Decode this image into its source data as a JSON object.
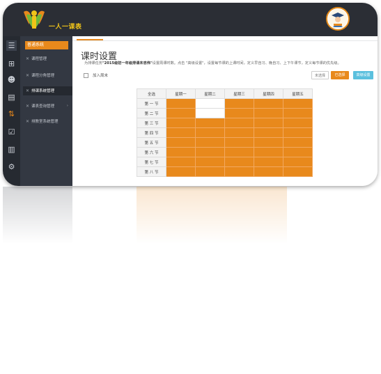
{
  "header": {
    "brand": "一人一课表",
    "colors": {
      "bar": "#2b2e35",
      "accent": "#e8891c"
    }
  },
  "iconbar": [
    {
      "icon": "list-icon",
      "glyph": "☰"
    },
    {
      "icon": "sitemap-icon",
      "glyph": "⊞"
    },
    {
      "icon": "users-icon",
      "glyph": "👥"
    },
    {
      "icon": "book-icon",
      "glyph": "▤"
    },
    {
      "icon": "sort-numeric-icon",
      "glyph": "⇅"
    },
    {
      "icon": "checkbox-icon",
      "glyph": "☑"
    },
    {
      "icon": "bar-chart-icon",
      "glyph": "▥"
    },
    {
      "icon": "gears-icon",
      "glyph": "⚙"
    }
  ],
  "sidebar": {
    "system_label": "普通系统",
    "items": [
      {
        "label": "课程管理",
        "icon": "wrench-icon"
      },
      {
        "label": "课程分角管理",
        "icon": "wrench-icon"
      },
      {
        "label": "排课系统管理",
        "icon": "wrench-icon",
        "active": true
      },
      {
        "label": "课表查询管理",
        "icon": "wrench-icon",
        "has_submenu": true
      },
      {
        "label": "排教室系统管理",
        "icon": "wrench-icon"
      }
    ]
  },
  "main": {
    "title": "课时设置",
    "description_prefix": "为排课任务",
    "description_task": "\"2015级初一年级排课未忠伟\"",
    "description_suffix": "设置周课时数。点击 \"高级设置\"，设置每节课的上课时间，定义早自习、晚自习、上下午课节，定义每节课的优先级。",
    "weekend_checkbox_label": "加入周末",
    "buttons": {
      "clear": "未选择",
      "selected": "已选择",
      "advanced": "高级设置"
    },
    "table": {
      "corner": "全选",
      "days": [
        "星期一",
        "星期二",
        "星期三",
        "星期四",
        "星期五"
      ],
      "periods": [
        "第 一 节",
        "第 二 节",
        "第 三 节",
        "第 四 节",
        "第 五 节",
        "第 六 节",
        "第 七 节",
        "第 八 节"
      ],
      "selected": [
        [
          true,
          false,
          true,
          true,
          true
        ],
        [
          true,
          false,
          true,
          true,
          true
        ],
        [
          true,
          true,
          true,
          true,
          true
        ],
        [
          true,
          true,
          true,
          true,
          true
        ],
        [
          true,
          true,
          true,
          true,
          true
        ],
        [
          true,
          true,
          true,
          true,
          true
        ],
        [
          true,
          true,
          true,
          true,
          true
        ],
        [
          true,
          true,
          true,
          true,
          true
        ]
      ]
    }
  }
}
